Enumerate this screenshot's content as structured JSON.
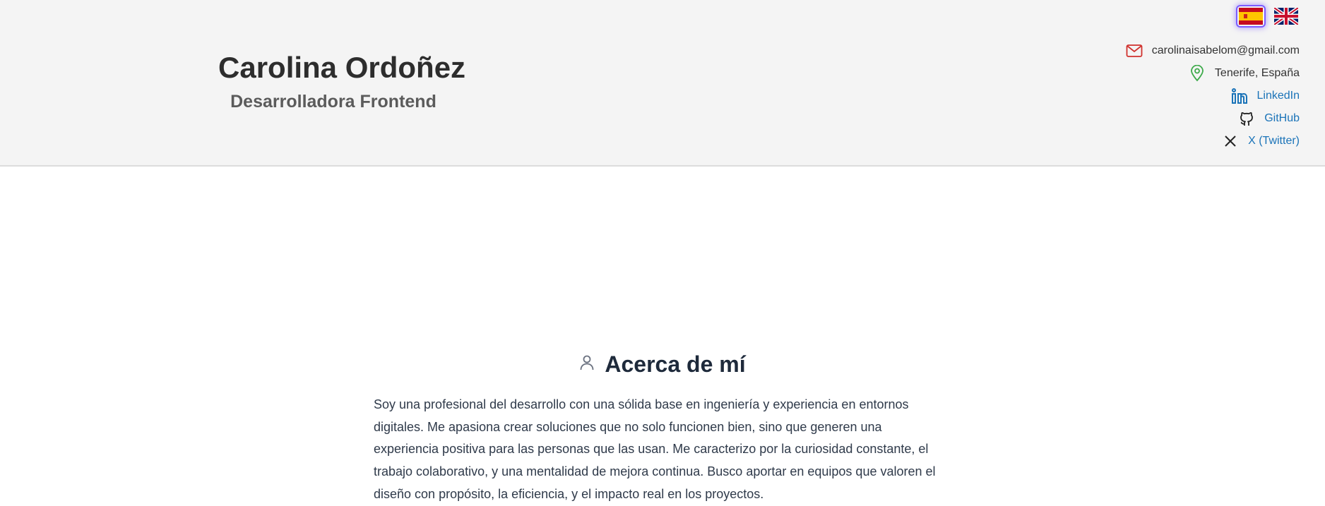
{
  "header": {
    "name": "Carolina Ordoñez",
    "role": "Desarrolladora Frontend"
  },
  "languages": [
    {
      "name": "Español",
      "icon": "spain-flag-icon",
      "active": true
    },
    {
      "name": "English",
      "icon": "uk-flag-icon",
      "active": false
    }
  ],
  "contacts": {
    "email": {
      "text": "carolinaisabelom@gmail.com",
      "icon": "mail-icon",
      "color": "#d0312d"
    },
    "location": {
      "text": "Tenerife, España",
      "icon": "location-pin-icon",
      "color": "#3daa4a"
    },
    "linkedin": {
      "text": "LinkedIn",
      "icon": "linkedin-icon",
      "color": "#1a73b8"
    },
    "github": {
      "text": "GitHub",
      "icon": "github-icon",
      "color": "#222222"
    },
    "twitter": {
      "text": "X (Twitter)",
      "icon": "x-icon",
      "color": "#222222"
    }
  },
  "about": {
    "title": "Acerca de mí",
    "icon": "user-icon",
    "paragraph": "Soy una profesional del desarrollo con una sólida base en ingeniería y experiencia en entornos digitales. Me apasiona crear soluciones que no solo funcionen bien, sino que generen una experiencia positiva para las personas que las usan. Me caracterizo por la curiosidad constante, el trabajo colaborativo, y una mentalidad de mejora continua. Busco aportar en equipos que valoren el diseño con propósito, la eficiencia, y el impacto real en los proyectos."
  },
  "colors": {
    "header_bg": "#f4f4f4",
    "link": "#1a73b8",
    "active_flag_glow": "#7c5cff"
  }
}
